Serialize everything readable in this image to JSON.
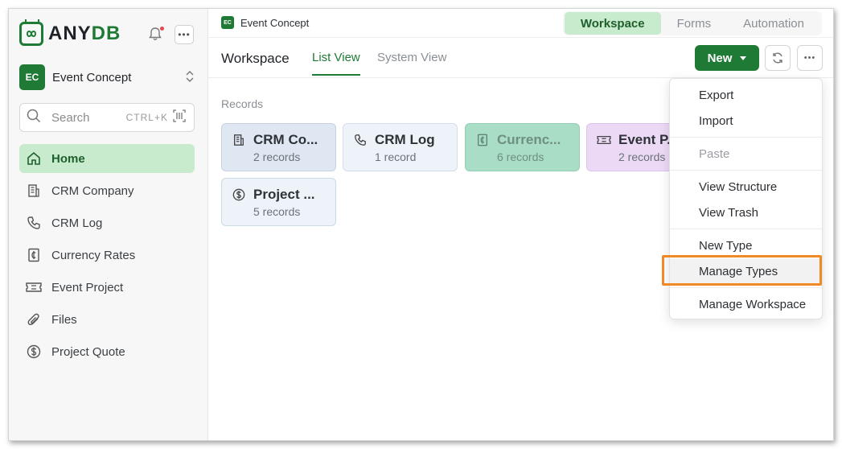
{
  "brand": {
    "name_prefix": "ANY",
    "name_suffix": "DB",
    "accent": "#1f7a36"
  },
  "workspace": {
    "initials": "EC",
    "name": "Event Concept"
  },
  "search": {
    "placeholder": "Search",
    "shortcut": "CTRL+K"
  },
  "sidebar": {
    "items": [
      {
        "label": "Home",
        "icon": "home-icon",
        "active": true
      },
      {
        "label": "CRM Company",
        "icon": "building-icon"
      },
      {
        "label": "CRM Log",
        "icon": "phone-icon"
      },
      {
        "label": "Currency Rates",
        "icon": "currency-icon"
      },
      {
        "label": "Event Project",
        "icon": "ticket-icon"
      },
      {
        "label": "Files",
        "icon": "paperclip-icon"
      },
      {
        "label": "Project Quote",
        "icon": "dollar-icon"
      }
    ]
  },
  "topbar": {
    "crumb_initials": "EC",
    "crumb_name": "Event Concept",
    "segments": [
      "Workspace",
      "Forms",
      "Automation"
    ],
    "active_segment": "Workspace"
  },
  "subbar": {
    "title": "Workspace",
    "tabs": [
      "List View",
      "System View"
    ],
    "active_tab": "List View",
    "new_label": "New"
  },
  "records": {
    "label": "Records",
    "cards": [
      {
        "title": "CRM Co...",
        "sub": "2 records",
        "icon": "building-icon",
        "color": "#dfe7f2"
      },
      {
        "title": "CRM Log",
        "sub": "1 record",
        "icon": "phone-icon",
        "color": "#eef3f9"
      },
      {
        "title": "Currenc...",
        "sub": "6 records",
        "icon": "currency-icon",
        "color": "#a9ddc6"
      },
      {
        "title": "Event P...",
        "sub": "2 records",
        "icon": "ticket-icon",
        "color": "#ecd9f5"
      },
      {
        "title": "Project ...",
        "sub": "5 records",
        "icon": "dollar-icon",
        "color": "#eef3f9"
      }
    ]
  },
  "menu": {
    "items": [
      {
        "label": "Export"
      },
      {
        "label": "Import"
      },
      {
        "label": "Paste",
        "disabled": true
      },
      {
        "label": "View Structure"
      },
      {
        "label": "View Trash"
      },
      {
        "label": "New Type"
      },
      {
        "label": "Manage Types",
        "highlight": true
      },
      {
        "label": "Manage Workspace"
      }
    ]
  }
}
